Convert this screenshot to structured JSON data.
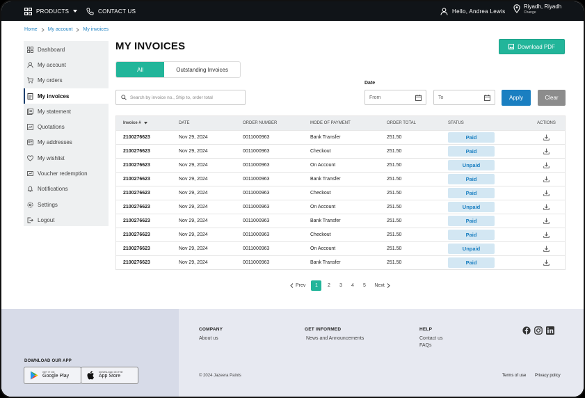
{
  "topbar": {
    "products": "PRODUCTS",
    "contact": "CONTACT US",
    "greeting": "Hello, Andrea Lewis",
    "location": "Riyadh, Riyadh",
    "location_change": "Change"
  },
  "breadcrumb": [
    "Home",
    "My account",
    "My invoices"
  ],
  "sidebar": {
    "items": [
      {
        "label": "Dashboard",
        "icon": "dashboard-icon"
      },
      {
        "label": "My account",
        "icon": "user-icon"
      },
      {
        "label": "My orders",
        "icon": "cart-icon"
      },
      {
        "label": "My invoices",
        "icon": "invoice-icon",
        "active": true
      },
      {
        "label": "My statement",
        "icon": "statement-icon"
      },
      {
        "label": "Quotations",
        "icon": "quotation-icon"
      },
      {
        "label": "My addresses",
        "icon": "address-icon"
      },
      {
        "label": "My wishlist",
        "icon": "heart-icon"
      },
      {
        "label": "Voucher redemption",
        "icon": "voucher-icon"
      },
      {
        "label": "Notifications",
        "icon": "bell-icon"
      },
      {
        "label": "Settings",
        "icon": "gear-icon"
      },
      {
        "label": "Logout",
        "icon": "logout-icon"
      }
    ]
  },
  "main": {
    "title": "MY INVOICES",
    "download_pdf": "Download PDF",
    "tabs": [
      "All",
      "Outstanding Invoices"
    ],
    "search_placeholder": "Search by invoice no., Ship to, order total",
    "date_label": "Date",
    "from": "From",
    "to": "To",
    "apply": "Apply",
    "clear": "Clear"
  },
  "table": {
    "headers": [
      "Invoice #",
      "DATE",
      "ORDER NUMBER",
      "MODE OF PAYMENT",
      "ORDER TOTAL",
      "STATUS",
      "ACTIONS"
    ],
    "rows": [
      {
        "invoice": "2100276623",
        "date": "Nov 29, 2024",
        "order": "0011000963",
        "mode": "Bank Transfer",
        "total": "251.50",
        "status": "Paid"
      },
      {
        "invoice": "2100276623",
        "date": "Nov 29, 2024",
        "order": "0011000963",
        "mode": "Checkout",
        "total": "251.50",
        "status": "Paid"
      },
      {
        "invoice": "2100276623",
        "date": "Nov 29, 2024",
        "order": "0011000963",
        "mode": "On Account",
        "total": "251.50",
        "status": "Unpaid"
      },
      {
        "invoice": "2100276623",
        "date": "Nov 29, 2024",
        "order": "0011000963",
        "mode": "Bank Transfer",
        "total": "251.50",
        "status": "Paid"
      },
      {
        "invoice": "2100276623",
        "date": "Nov 29, 2024",
        "order": "0011000963",
        "mode": "Checkout",
        "total": "251.50",
        "status": "Paid"
      },
      {
        "invoice": "2100276623",
        "date": "Nov 29, 2024",
        "order": "0011000963",
        "mode": "On Account",
        "total": "251.50",
        "status": "Unpaid"
      },
      {
        "invoice": "2100276623",
        "date": "Nov 29, 2024",
        "order": "0011000963",
        "mode": "Bank Transfer",
        "total": "251.50",
        "status": "Paid"
      },
      {
        "invoice": "2100276623",
        "date": "Nov 29, 2024",
        "order": "0011000963",
        "mode": "Checkout",
        "total": "251.50",
        "status": "Paid"
      },
      {
        "invoice": "2100276623",
        "date": "Nov 29, 2024",
        "order": "0011000963",
        "mode": "On Account",
        "total": "251.50",
        "status": "Unpaid"
      },
      {
        "invoice": "2100276623",
        "date": "Nov 29, 2024",
        "order": "0011000963",
        "mode": "Bank Transfer",
        "total": "251.50",
        "status": "Paid"
      }
    ]
  },
  "pagination": {
    "prev": "Prev",
    "next": "Next",
    "pages": [
      "1",
      "2",
      "3",
      "4",
      "5"
    ],
    "current": "1"
  },
  "footer": {
    "download_app": "DOWNLOAD OUR APP",
    "google_small": "GET IT ON",
    "google_big": "Google Play",
    "apple_small": "DOWNLOAD ON THE",
    "apple_big": "App Store",
    "company": {
      "heading": "COMPANY",
      "links": [
        "About us"
      ]
    },
    "informed": {
      "heading": "GET INFORMED",
      "links": [
        "News and Announcements"
      ]
    },
    "help": {
      "heading": "HELP",
      "links": [
        "Contact us",
        "FAQs"
      ]
    },
    "copyright": "© 2024 Jazeera Paints",
    "terms": "Terms of use",
    "privacy": "Privacy policy"
  },
  "colors": {
    "accent": "#22b59a",
    "primary_blue": "#1a7fc1",
    "topbar": "#101418",
    "badge_bg": "#d3e7f3"
  }
}
